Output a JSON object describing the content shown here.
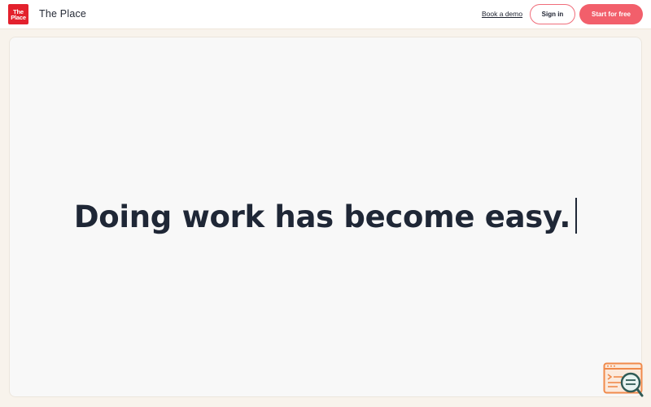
{
  "header": {
    "logo_text": "The Place",
    "brand_name": "The Place",
    "book_demo_label": "Book a demo",
    "sign_in_label": "Sign in",
    "start_label": "Start for free"
  },
  "hero": {
    "headline": "Doing work has become easy."
  },
  "widget": {
    "icon": "search-document-icon"
  },
  "colors": {
    "brand_red": "#e3212d",
    "accent": "#f25f6b",
    "text_dark": "#1f2736",
    "background": "#f8f3ec"
  }
}
